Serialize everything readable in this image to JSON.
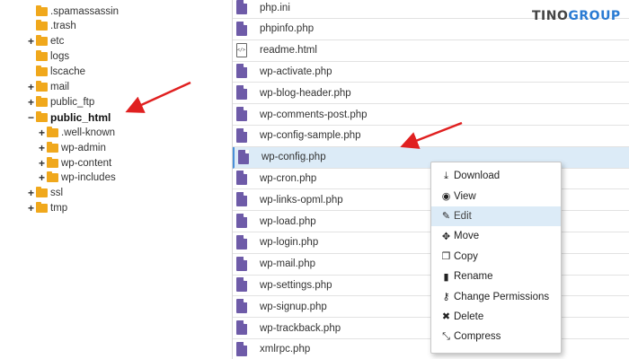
{
  "logo": {
    "part1": "TINO",
    "part2": "GROUP"
  },
  "tree": [
    {
      "label": ".spamassassin",
      "toggle": "",
      "indent": 1
    },
    {
      "label": ".trash",
      "toggle": "",
      "indent": 1
    },
    {
      "label": "etc",
      "toggle": "+",
      "indent": 1
    },
    {
      "label": "logs",
      "toggle": "",
      "indent": 1
    },
    {
      "label": "lscache",
      "toggle": "",
      "indent": 1
    },
    {
      "label": "mail",
      "toggle": "+",
      "indent": 1
    },
    {
      "label": "public_ftp",
      "toggle": "+",
      "indent": 1
    },
    {
      "label": "public_html",
      "toggle": "−",
      "indent": 1,
      "bold": true
    },
    {
      "label": ".well-known",
      "toggle": "+",
      "indent": 2
    },
    {
      "label": "wp-admin",
      "toggle": "+",
      "indent": 2
    },
    {
      "label": "wp-content",
      "toggle": "+",
      "indent": 2
    },
    {
      "label": "wp-includes",
      "toggle": "+",
      "indent": 2
    },
    {
      "label": "ssl",
      "toggle": "+",
      "indent": 1
    },
    {
      "label": "tmp",
      "toggle": "+",
      "indent": 1
    }
  ],
  "files": [
    {
      "name": "php.ini",
      "type": "php"
    },
    {
      "name": "phpinfo.php",
      "type": "php"
    },
    {
      "name": "readme.html",
      "type": "html"
    },
    {
      "name": "wp-activate.php",
      "type": "php"
    },
    {
      "name": "wp-blog-header.php",
      "type": "php"
    },
    {
      "name": "wp-comments-post.php",
      "type": "php"
    },
    {
      "name": "wp-config-sample.php",
      "type": "php"
    },
    {
      "name": "wp-config.php",
      "type": "php",
      "selected": true
    },
    {
      "name": "wp-cron.php",
      "type": "php"
    },
    {
      "name": "wp-links-opml.php",
      "type": "php"
    },
    {
      "name": "wp-load.php",
      "type": "php"
    },
    {
      "name": "wp-login.php",
      "type": "php"
    },
    {
      "name": "wp-mail.php",
      "type": "php"
    },
    {
      "name": "wp-settings.php",
      "type": "php"
    },
    {
      "name": "wp-signup.php",
      "type": "php"
    },
    {
      "name": "wp-trackback.php",
      "type": "php"
    },
    {
      "name": "xmlrpc.php",
      "type": "php"
    }
  ],
  "context_menu": [
    {
      "label": "Download",
      "icon": "download-icon",
      "glyph": "⤓"
    },
    {
      "label": "View",
      "icon": "eye-icon",
      "glyph": "◉"
    },
    {
      "label": "Edit",
      "icon": "pencil-icon",
      "glyph": "✎",
      "hover": true
    },
    {
      "label": "Move",
      "icon": "move-icon",
      "glyph": "✥"
    },
    {
      "label": "Copy",
      "icon": "copy-icon",
      "glyph": "❐"
    },
    {
      "label": "Rename",
      "icon": "file-icon",
      "glyph": "▮"
    },
    {
      "label": "Change Permissions",
      "icon": "key-icon",
      "glyph": "⚷"
    },
    {
      "label": "Delete",
      "icon": "delete-icon",
      "glyph": "✖"
    },
    {
      "label": "Compress",
      "icon": "compress-icon",
      "glyph": "⤡"
    }
  ],
  "colors": {
    "folder": "#f0a81c",
    "php_file": "#6e5ba8",
    "selected_row": "#dcebf7",
    "arrow": "#e02020",
    "logo_accent": "#2a7bd3"
  }
}
